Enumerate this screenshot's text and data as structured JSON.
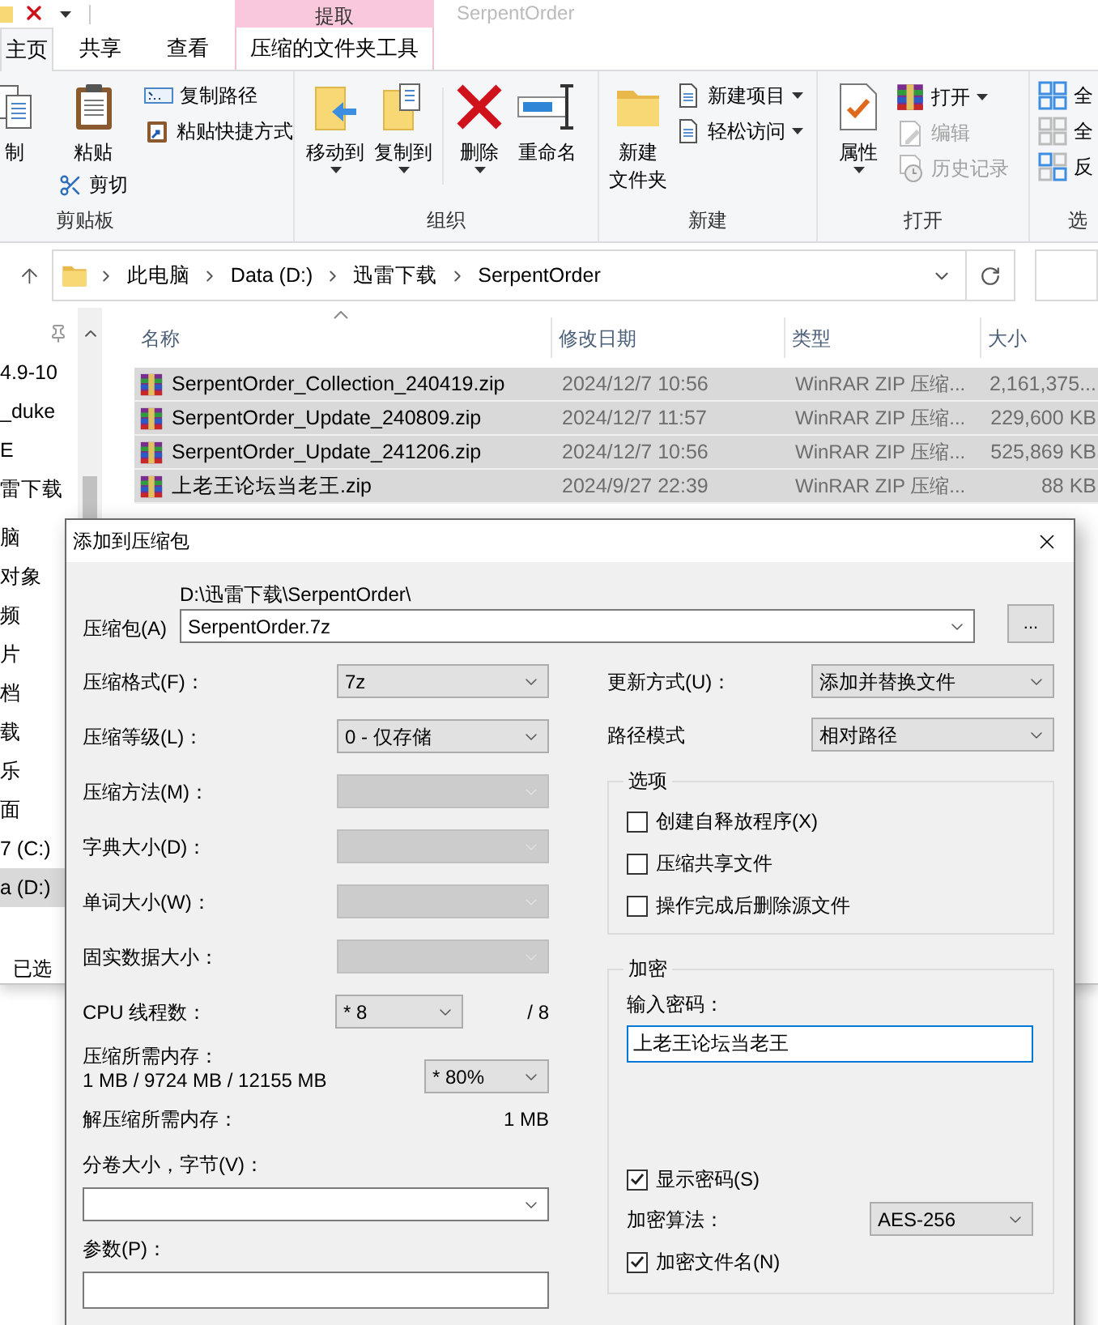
{
  "titlebar": {
    "contextual_tab": "提取",
    "title": "SerpentOrder"
  },
  "ribbon_tabs": [
    {
      "label": "主页",
      "selected": true,
      "kind": "normal"
    },
    {
      "label": "共享",
      "selected": false,
      "kind": "normal"
    },
    {
      "label": "查看",
      "selected": false,
      "kind": "normal"
    },
    {
      "label": "压缩的文件夹工具",
      "selected": false,
      "kind": "contextual"
    }
  ],
  "ribbon_groups": [
    {
      "label": "剪贴板",
      "buttons": [
        {
          "label": "制",
          "dropdown": false,
          "disabled": false
        },
        {
          "label": "粘贴",
          "dropdown": false,
          "disabled": false
        },
        {
          "label": "剪切",
          "dropdown": false,
          "disabled": false
        },
        {
          "label": "复制路径",
          "dropdown": false,
          "disabled": false
        },
        {
          "label": "粘贴快捷方式",
          "dropdown": false,
          "disabled": false
        }
      ]
    },
    {
      "label": "组织",
      "buttons": [
        {
          "label": "移动到",
          "dropdown": true,
          "disabled": false
        },
        {
          "label": "复制到",
          "dropdown": true,
          "disabled": false
        },
        {
          "label": "删除",
          "dropdown": true,
          "disabled": false
        },
        {
          "label": "重命名",
          "dropdown": false,
          "disabled": false
        }
      ]
    },
    {
      "label": "新建",
      "buttons": [
        {
          "lines": [
            "新建",
            "文件夹"
          ],
          "dropdown": false,
          "disabled": false
        },
        {
          "label": "新建项目",
          "dropdown": true,
          "disabled": false
        },
        {
          "label": "轻松访问",
          "dropdown": true,
          "disabled": false
        }
      ]
    },
    {
      "label": "打开",
      "buttons": [
        {
          "label": "属性",
          "dropdown": true,
          "disabled": false
        },
        {
          "label": "打开",
          "dropdown": true,
          "disabled": false
        },
        {
          "label": "编辑",
          "dropdown": false,
          "disabled": true
        },
        {
          "label": "历史记录",
          "dropdown": false,
          "disabled": true
        }
      ]
    },
    {
      "label": "选",
      "buttons": [
        {
          "label": "全",
          "dropdown": false,
          "disabled": false
        },
        {
          "label": "全",
          "dropdown": false,
          "disabled": false
        },
        {
          "label": "反",
          "dropdown": false,
          "disabled": false
        }
      ]
    }
  ],
  "address": {
    "crumbs": [
      "此电脑",
      "Data (D:)",
      "迅雷下载",
      "SerpentOrder"
    ]
  },
  "sidebar": {
    "sections": [
      {
        "items": [
          {
            "label": "4.9-10",
            "selected": false
          },
          {
            "label": "_duke",
            "selected": false
          },
          {
            "label": "E",
            "selected": false
          },
          {
            "label": "雷下载",
            "selected": false
          }
        ]
      },
      {
        "items": [
          {
            "label": "脑",
            "selected": false
          },
          {
            "label": "对象",
            "selected": false
          },
          {
            "label": "频",
            "selected": false
          },
          {
            "label": "片",
            "selected": false
          },
          {
            "label": "档",
            "selected": false
          },
          {
            "label": "载",
            "selected": false
          },
          {
            "label": "乐",
            "selected": false
          },
          {
            "label": "面",
            "selected": false
          },
          {
            "label": "7 (C:)",
            "selected": false
          },
          {
            "label": "a (D:)",
            "selected": true
          }
        ]
      }
    ]
  },
  "file_list": {
    "columns": [
      "名称",
      "修改日期",
      "类型",
      "大小"
    ],
    "rows": [
      {
        "name": "SerpentOrder_Collection_240419.zip",
        "date": "2024/12/7 10:56",
        "type": "WinRAR ZIP 压缩...",
        "size": "2,161,375...",
        "selected": true
      },
      {
        "name": "SerpentOrder_Update_240809.zip",
        "date": "2024/12/7 11:57",
        "type": "WinRAR ZIP 压缩...",
        "size": "229,600 KB",
        "selected": true
      },
      {
        "name": "SerpentOrder_Update_241206.zip",
        "date": "2024/12/7 10:56",
        "type": "WinRAR ZIP 压缩...",
        "size": "525,869 KB",
        "selected": true
      },
      {
        "name": "上老王论坛当老王.zip",
        "date": "2024/9/27 22:39",
        "type": "WinRAR ZIP 压缩...",
        "size": "88 KB",
        "selected": true
      }
    ]
  },
  "status_bar": "已选",
  "dialog": {
    "title": "添加到压缩包",
    "archive_label": "压缩包(A)",
    "archive_folder": "D:\\迅雷下载\\SerpentOrder\\",
    "archive_name": "SerpentOrder.7z",
    "browse": "...",
    "left_rows": [
      {
        "kind": "combo",
        "label": "压缩格式(F)：",
        "value": "7z",
        "disabled": false
      },
      {
        "kind": "combo",
        "label": "压缩等级(L)：",
        "value": "0 - 仅存储",
        "disabled": false
      },
      {
        "kind": "combo",
        "label": "压缩方法(M)：",
        "disabled": true
      },
      {
        "kind": "combo",
        "label": "字典大小(D)：",
        "disabled": true
      },
      {
        "kind": "combo",
        "label": "单词大小(W)：",
        "disabled": true
      },
      {
        "kind": "combo",
        "label": "固实数据大小：",
        "disabled": true
      },
      {
        "kind": "threads",
        "label": "CPU 线程数：",
        "value": "* 8",
        "max": "/ 8"
      },
      {
        "kind": "memory",
        "label": "压缩所需内存：",
        "detail": "1 MB / 9724 MB / 12155 MB",
        "value": "* 80%"
      },
      {
        "kind": "info",
        "label": "解压缩所需内存：",
        "value": "1 MB"
      },
      {
        "kind": "volume",
        "label": "分卷大小，字节(V)："
      },
      {
        "kind": "params",
        "label": "参数(P)："
      }
    ],
    "right_rows": [
      {
        "label": "更新方式(U)：",
        "value": "添加并替换文件"
      },
      {
        "label": "路径模式",
        "value": "相对路径"
      }
    ],
    "options": {
      "title": "选项",
      "checkboxes": [
        {
          "label": "创建自释放程序(X)",
          "checked": false
        },
        {
          "label": "压缩共享文件",
          "checked": false
        },
        {
          "label": "操作完成后删除源文件",
          "checked": false
        }
      ]
    },
    "encryption": {
      "title": "加密",
      "password_label": "输入密码：",
      "password": "上老王论坛当老王",
      "show_password": {
        "label": "显示密码(S)",
        "checked": true
      },
      "algorithm_label": "加密算法：",
      "algorithm": "AES-256",
      "encrypt_names": {
        "label": "加密文件名(N)",
        "checked": true
      }
    }
  }
}
